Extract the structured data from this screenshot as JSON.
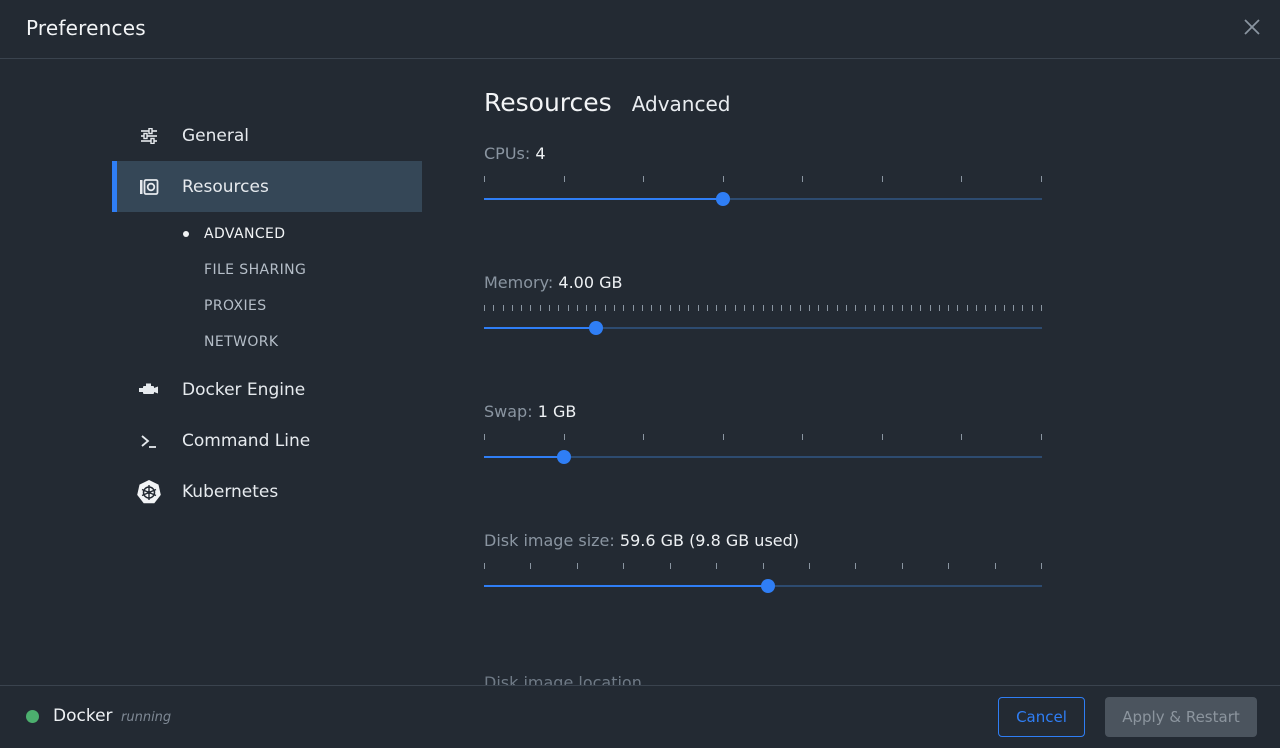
{
  "window": {
    "title": "Preferences",
    "close_icon": "close-icon"
  },
  "sidebar": {
    "items": [
      {
        "key": "general",
        "label": "General",
        "icon": "sliders-icon",
        "active": false
      },
      {
        "key": "resources",
        "label": "Resources",
        "icon": "resources-icon",
        "active": true
      },
      {
        "key": "docker-engine",
        "label": "Docker Engine",
        "icon": "engine-icon",
        "active": false
      },
      {
        "key": "command-line",
        "label": "Command Line",
        "icon": "terminal-icon",
        "active": false
      },
      {
        "key": "kubernetes",
        "label": "Kubernetes",
        "icon": "kubernetes-icon",
        "active": false
      }
    ],
    "sub_items": [
      {
        "label": "ADVANCED",
        "current": true
      },
      {
        "label": "FILE SHARING",
        "current": false
      },
      {
        "label": "PROXIES",
        "current": false
      },
      {
        "label": "NETWORK",
        "current": false
      }
    ]
  },
  "content": {
    "breadcrumb_main": "Resources",
    "breadcrumb_sub": "Advanced",
    "settings": [
      {
        "key": "cpus",
        "label": "CPUs:",
        "value": "4",
        "fraction": 0.4286,
        "tick_count": 8
      },
      {
        "key": "memory",
        "label": "Memory:",
        "value": "4.00 GB",
        "fraction": 0.2,
        "tick_count": 61
      },
      {
        "key": "swap",
        "label": "Swap:",
        "value": "1 GB",
        "fraction": 0.1429,
        "tick_count": 8
      },
      {
        "key": "disk",
        "label": "Disk image size:",
        "value": "59.6 GB (9.8 GB used)",
        "fraction": 0.5094,
        "tick_count": 13
      }
    ],
    "next_section_label": "Disk image location"
  },
  "footer": {
    "status_name": "Docker",
    "status_state": "running",
    "status_color": "#4caf6e",
    "cancel_label": "Cancel",
    "apply_label": "Apply & Restart"
  },
  "colors": {
    "accent": "#2f7ef5",
    "background": "#232a33",
    "active_nav": "#354757"
  }
}
